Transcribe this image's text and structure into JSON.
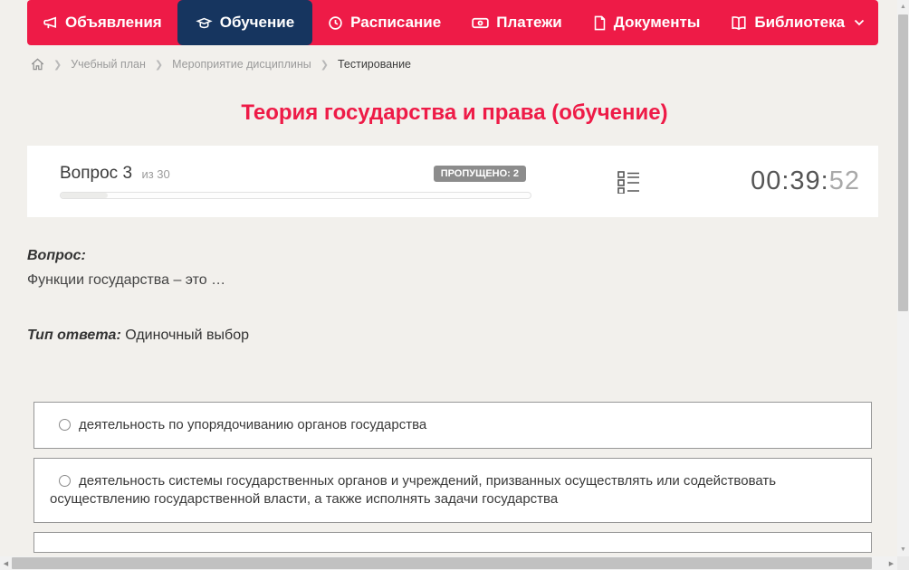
{
  "nav": {
    "items": [
      {
        "label": "Объявления",
        "icon": "megaphone-icon",
        "active": false
      },
      {
        "label": "Обучение",
        "icon": "graduation-cap-icon",
        "active": true
      },
      {
        "label": "Расписание",
        "icon": "clock-icon",
        "active": false
      },
      {
        "label": "Платежи",
        "icon": "banknote-icon",
        "active": false
      },
      {
        "label": "Документы",
        "icon": "document-icon",
        "active": false
      },
      {
        "label": "Библиотека",
        "icon": "book-icon",
        "active": false,
        "has_dropdown": true
      }
    ]
  },
  "breadcrumb": {
    "items": [
      "Учебный план",
      "Мероприятие дисциплины",
      "Тестирование"
    ]
  },
  "page": {
    "title": "Теория государства и права (обучение)"
  },
  "question_header": {
    "question_label": "Вопрос 3",
    "of_label": "из 30",
    "skipped_badge": "ПРОПУЩЕНО: 2",
    "timer": {
      "hours_minutes": "00:39:",
      "seconds": "52"
    },
    "progress_percent": 10
  },
  "question": {
    "caption": "Вопрос:",
    "text": "Функции государства – это …",
    "answer_type_label": "Тип ответа:",
    "answer_type_value": "Одиночный выбор"
  },
  "options": [
    {
      "label": "деятельность по упорядочиванию органов государства",
      "selected": false
    },
    {
      "label": "деятельность системы государственных органов и учреждений, призванных осуществлять или содействовать осуществлению государственной власти, а также исполнять задачи государства",
      "selected": false
    },
    {
      "label": "",
      "selected": false
    }
  ],
  "colors": {
    "accent_red": "#ee1b47",
    "active_navy": "#16355f",
    "badge_gray": "#8c8c8c"
  }
}
